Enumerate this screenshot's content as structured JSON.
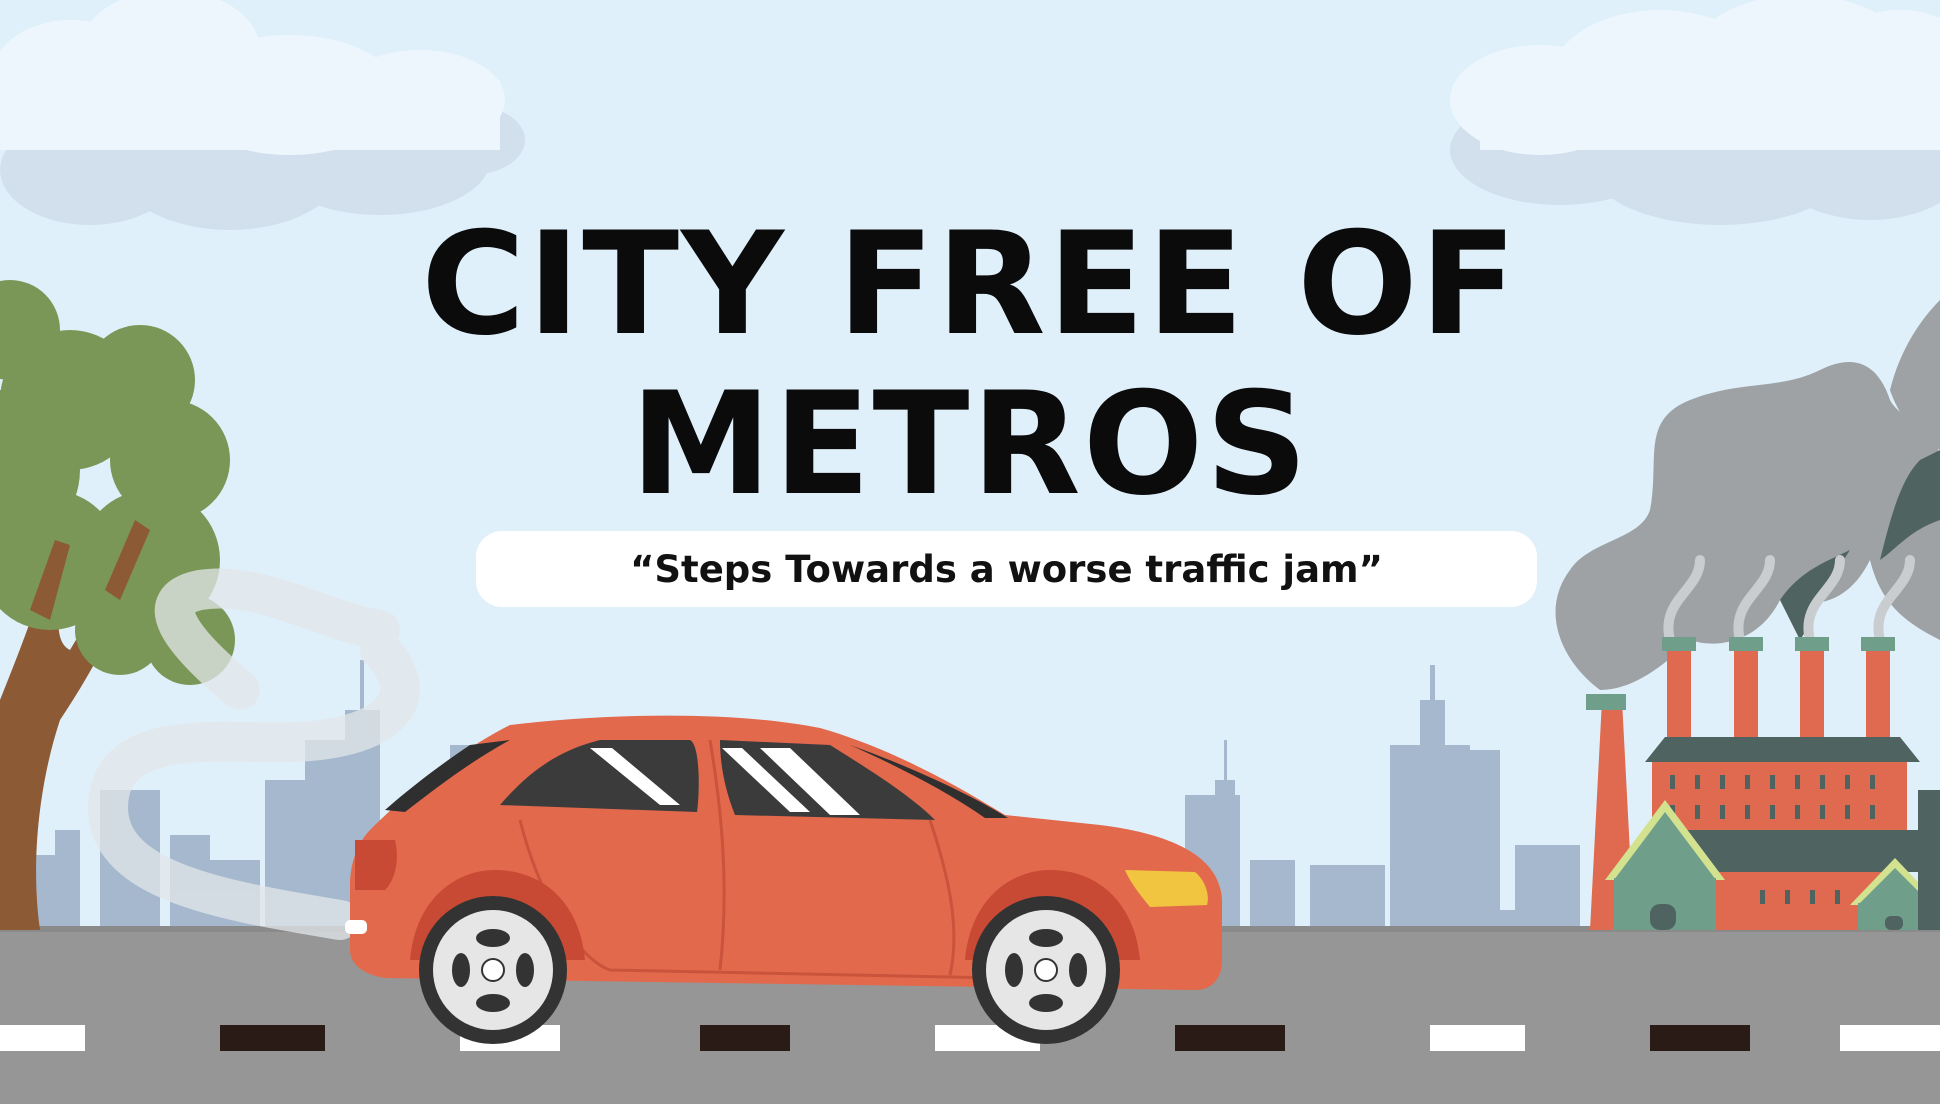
{
  "title": {
    "line1": "CITY FREE OF",
    "line2": "METROS"
  },
  "subtitle": "“Steps Towards a worse traffic jam”",
  "colors": {
    "sky": "#dff0fb",
    "road": "#969696",
    "car": "#e2694c",
    "tree": "#7b9757",
    "factory": "#e06a4f",
    "smoke": "#9ea2a4",
    "skyline": "#a5b8cd",
    "title": "#0b0b0b"
  },
  "icons": [
    "cloud-icon",
    "tree-icon",
    "car-icon",
    "factory-icon",
    "smoke-icon",
    "skyline-icon"
  ]
}
